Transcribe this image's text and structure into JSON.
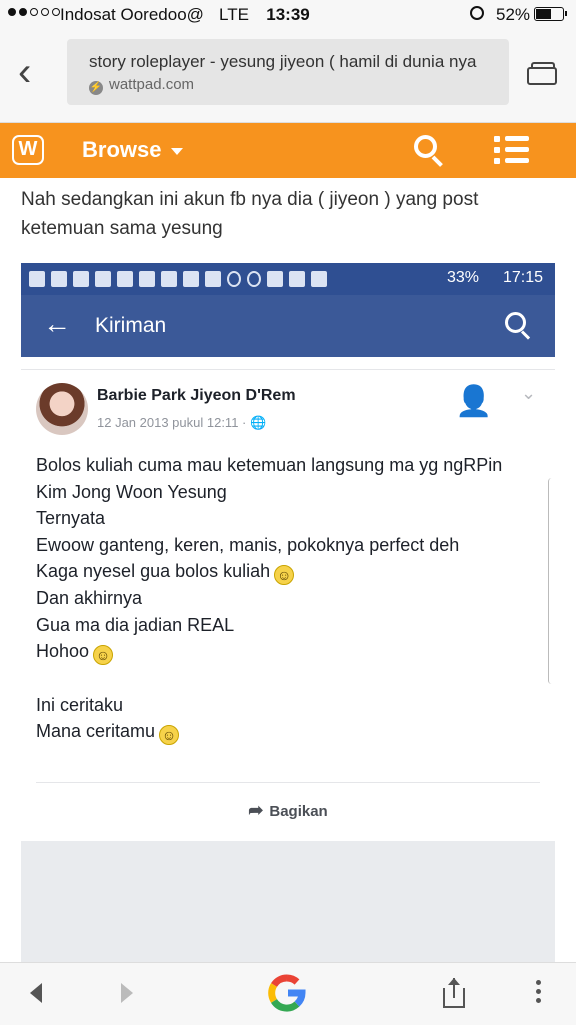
{
  "status_bar": {
    "carrier": "Indosat Ooredoo@",
    "network": "LTE",
    "time": "13:39",
    "battery": "52%",
    "battery_level": 0.52
  },
  "browser": {
    "page_title": "story roleplayer - yesung jiyeon ( hamil di dunia nya",
    "domain": "wattpad.com"
  },
  "wattpad_header": {
    "logo_letter": "W",
    "browse_label": "Browse",
    "accent_color": "#f7931e"
  },
  "article": {
    "paragraph": "Nah sedangkan ini akun fb nya dia ( jiyeon ) yang post ketemuan sama yesung"
  },
  "embedded_screenshot": {
    "android_status": {
      "battery": "33%",
      "time": "17:15"
    },
    "fb_header": {
      "title": "Kiriman"
    },
    "post": {
      "author": "Barbie Park Jiyeon D'Rem",
      "meta": "12 Jan 2013 pukul 12:11 · ",
      "lines": [
        "Bolos kuliah cuma mau ketemuan langsung ma yg ngRPin",
        "Kim Jong Woon Yesung",
        "Ternyata",
        "Ewoow ganteng, keren, manis, pokoknya perfect deh",
        "Kaga nyesel gua bolos kuliah",
        "Dan akhirnya",
        "Gua ma dia jadian REAL",
        "Hohoo",
        "",
        "Ini ceritaku",
        "Mana ceritamu"
      ],
      "share_label": "Bagikan"
    },
    "fb_color": "#3b5998"
  }
}
